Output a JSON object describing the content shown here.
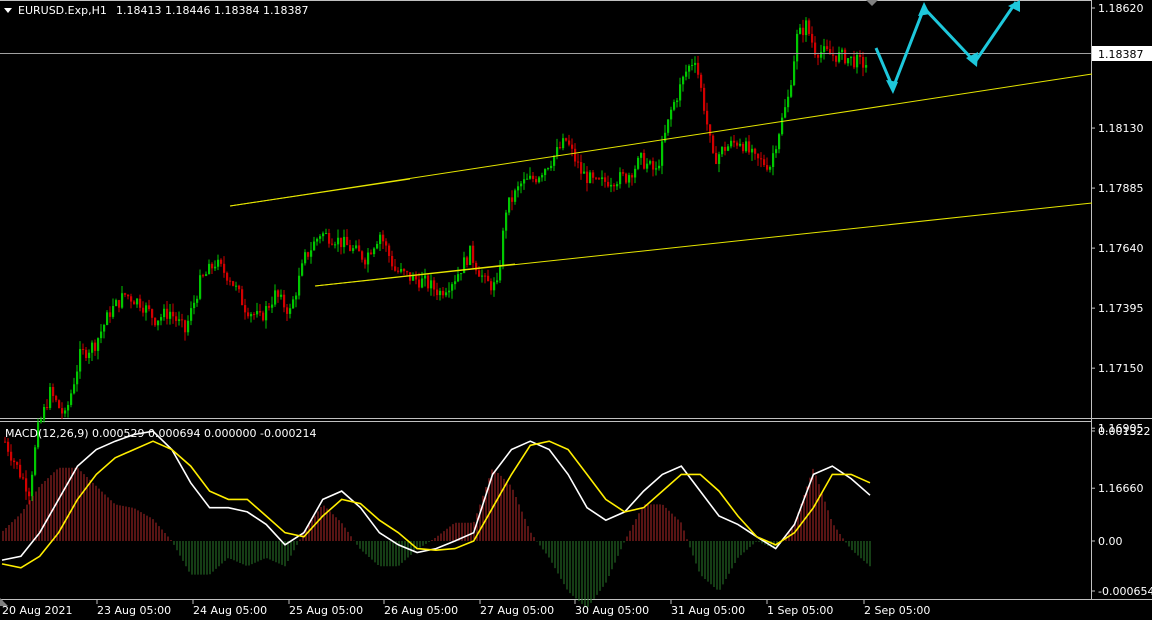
{
  "header": {
    "symbol": "EURUSD.Exp,H1",
    "ohlc": "1.18413 1.18446 1.18384 1.18387"
  },
  "price_panel": {
    "y_ticks": [
      "1.18620",
      "1.18130",
      "1.17885",
      "1.17640",
      "1.17395",
      "1.17150",
      "1.16905",
      "1.16660"
    ],
    "current_price_label": "1.18387"
  },
  "macd_panel": {
    "label": "MACD(12,26,9) 0.000529 0.000694 0.000000 -0.000214",
    "y_ticks": [
      "0.001322",
      "0.00",
      "-0.000654"
    ]
  },
  "time_axis": {
    "labels": [
      "20 Aug 2021",
      "23 Aug 05:00",
      "24 Aug 05:00",
      "25 Aug 05:00",
      "26 Aug 05:00",
      "27 Aug 05:00",
      "30 Aug 05:00",
      "31 Aug 05:00",
      "1 Sep 05:00",
      "2 Sep 05:00"
    ]
  },
  "colors": {
    "background": "#000000",
    "bull": "#00c800",
    "bear": "#d20000",
    "trendline": "#e6e600",
    "forecast_arrow": "#1ec8dc",
    "macd_line": "#ffffff",
    "signal_line": "#ffee00",
    "hist_pos": "#b02828",
    "hist_neg": "#2a7a2a",
    "grid_line": "#c0c0c0"
  },
  "chart_data": [
    {
      "type": "candlestick",
      "ylim": [
        1.1655,
        1.1868
      ],
      "current_price": 1.18387,
      "path_points": [
        [
          0,
          1.1685
        ],
        [
          5,
          1.1672
        ],
        [
          8,
          1.1665
        ],
        [
          11,
          1.169
        ],
        [
          15,
          1.1705
        ],
        [
          20,
          1.1695
        ],
        [
          25,
          1.172
        ],
        [
          30,
          1.1725
        ],
        [
          35,
          1.1738
        ],
        [
          40,
          1.1745
        ],
        [
          45,
          1.1742
        ],
        [
          50,
          1.1735
        ],
        [
          55,
          1.1738
        ],
        [
          60,
          1.173
        ],
        [
          65,
          1.175
        ],
        [
          70,
          1.1758
        ],
        [
          75,
          1.1752
        ],
        [
          80,
          1.174
        ],
        [
          85,
          1.1735
        ],
        [
          90,
          1.1745
        ],
        [
          95,
          1.1738
        ],
        [
          100,
          1.176
        ],
        [
          105,
          1.177
        ],
        [
          110,
          1.1768
        ],
        [
          115,
          1.1764
        ],
        [
          120,
          1.176
        ],
        [
          125,
          1.177
        ],
        [
          130,
          1.1755
        ],
        [
          135,
          1.1752
        ],
        [
          140,
          1.175
        ],
        [
          145,
          1.1746
        ],
        [
          150,
          1.1752
        ],
        [
          155,
          1.1762
        ],
        [
          160,
          1.175
        ],
        [
          164,
          1.1748
        ],
        [
          167,
          1.178
        ],
        [
          172,
          1.179
        ],
        [
          177,
          1.1793
        ],
        [
          182,
          1.18
        ],
        [
          187,
          1.1808
        ],
        [
          192,
          1.1795
        ],
        [
          197,
          1.179
        ],
        [
          202,
          1.1792
        ],
        [
          207,
          1.1793
        ],
        [
          212,
          1.18
        ],
        [
          217,
          1.1795
        ],
        [
          222,
          1.182
        ],
        [
          227,
          1.1836
        ],
        [
          230,
          1.1842
        ],
        [
          233,
          1.1822
        ],
        [
          236,
          1.18
        ],
        [
          240,
          1.1805
        ],
        [
          245,
          1.1808
        ],
        [
          250,
          1.18
        ],
        [
          255,
          1.1798
        ],
        [
          258,
          1.1812
        ],
        [
          261,
          1.1825
        ],
        [
          264,
          1.185
        ],
        [
          267,
          1.1855
        ],
        [
          270,
          1.1845
        ],
        [
          275,
          1.1843
        ],
        [
          280,
          1.1842
        ],
        [
          284,
          1.184
        ],
        [
          287,
          1.18387
        ]
      ]
    },
    {
      "type": "line",
      "series": [
        {
          "values": [
            -0.00025,
            -0.0002,
            0.0001,
            0.0005,
            0.0009,
            0.0011,
            0.0012,
            0.00128,
            0.00132,
            0.0011,
            0.0007,
            0.0004,
            0.0004,
            0.00035,
            0.0002,
            -5e-05,
            0.0001,
            0.0005,
            0.0006,
            0.0004,
            0.0001,
            -5e-05,
            -0.00015,
            -0.0001,
            0.0,
            0.0001,
            0.0008,
            0.0011,
            0.0012,
            0.0011,
            0.0008,
            0.0004,
            0.00025,
            0.00035,
            0.0006,
            0.0008,
            0.0009,
            0.0006,
            0.0003,
            0.0002,
            5e-05,
            -0.0001,
            0.0002,
            0.0008,
            0.0009,
            0.00075,
            0.00055
          ]
        },
        {
          "values": [
            -0.0003,
            -0.00035,
            -0.0002,
            0.0001,
            0.0005,
            0.0008,
            0.001,
            0.0011,
            0.0012,
            0.0011,
            0.0009,
            0.0006,
            0.0005,
            0.0005,
            0.0003,
            0.0001,
            5e-05,
            0.0003,
            0.0005,
            0.00045,
            0.00025,
            0.0001,
            -0.0001,
            -0.00012,
            -0.0001,
            0.0,
            0.0004,
            0.0008,
            0.00115,
            0.0012,
            0.0011,
            0.0008,
            0.0005,
            0.00035,
            0.0004,
            0.0006,
            0.0008,
            0.0008,
            0.0006,
            0.0003,
            5e-05,
            -5e-05,
            0.0001,
            0.0004,
            0.0008,
            0.0008,
            0.0007
          ]
        }
      ],
      "ylim": [
        -0.000654,
        0.001322
      ]
    }
  ]
}
